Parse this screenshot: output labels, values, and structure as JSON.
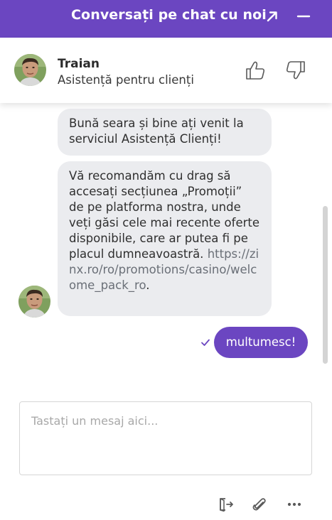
{
  "header": {
    "title": "Conversați pe chat cu noi",
    "icons": [
      "external-link-icon",
      "minimize-icon"
    ]
  },
  "agent": {
    "name": "Traian",
    "role": "Asistență pentru clienți",
    "icons": [
      "thumbs-up-icon",
      "thumbs-down-icon"
    ]
  },
  "messages": [
    {
      "from": "agent",
      "text": "Bună seara și bine ați venit la serviciul Asistență Clienți!"
    },
    {
      "from": "agent",
      "text": "Vă recomandăm cu drag să accesați secțiunea „Promoții” de pe platforma nostra, unde veți găsi cele mai recente oferte disponibile, care ar putea fi pe placul dumneavoastră.",
      "link": "https://zinx.ro/ro/promotions/casino/welcome_pack_ro",
      "suffix": "."
    },
    {
      "from": "user",
      "text": "multumesc!",
      "status": "delivered"
    }
  ],
  "composer": {
    "placeholder": "Tastați un mesaj aici...",
    "value": ""
  },
  "toolbar": {
    "icons": [
      "exit-icon",
      "paperclip-icon",
      "more-icon"
    ]
  },
  "colors": {
    "brand": "#6b46c1",
    "bubble_agent": "#ebecef",
    "text": "#2b2b2b"
  }
}
